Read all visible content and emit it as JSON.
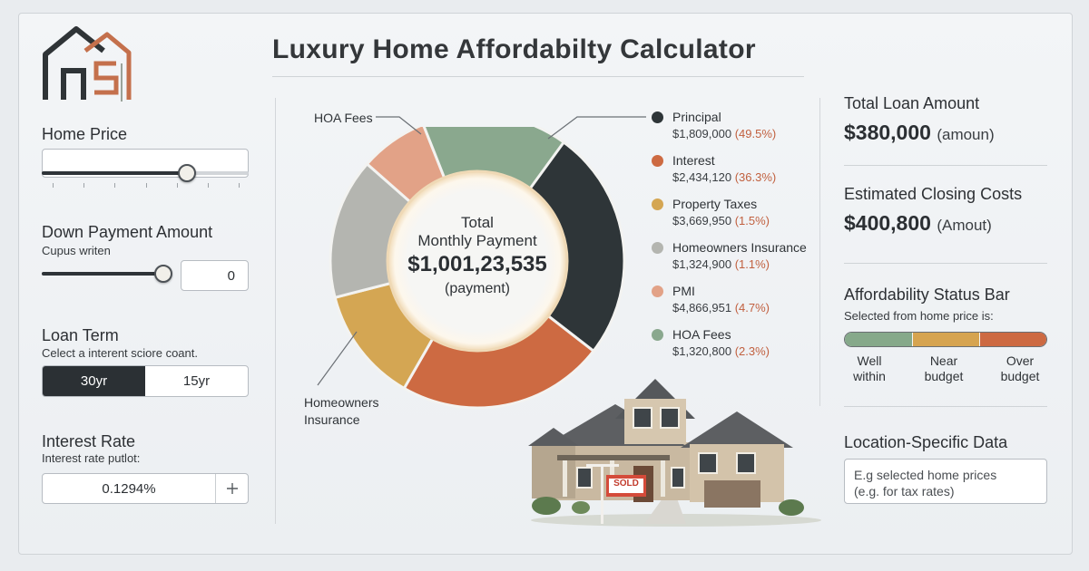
{
  "title": "Luxury Home Affordabilty Calculator",
  "colors": {
    "principal": "#2e3538",
    "interest": "#cd6a42",
    "property_taxes": "#d4a653",
    "homeowners_insurance": "#b4b5b0",
    "pmi": "#e2a287",
    "hoa_fees": "#8aa88e"
  },
  "inputs": {
    "home_price": {
      "label": "Home Price",
      "slider_level": 0.7
    },
    "down_payment": {
      "label": "Down Payment Amount",
      "caption": "Cupus writen",
      "value": "0",
      "slider_level": 1.0
    },
    "loan_term": {
      "label": "Loan Term",
      "caption": "Celect a interent sciore coant.",
      "options": [
        "30yr",
        "15yr"
      ],
      "selected": "30yr"
    },
    "interest_rate": {
      "label": "Interest Rate",
      "caption": "Interest rate putlot:",
      "value": "0.1294%",
      "stepper_icon": "plus-icon"
    }
  },
  "donut": {
    "center_line1": "Total",
    "center_line2": "Monthly Payment",
    "center_value": "$1,001,23,535",
    "center_unit": "(payment)",
    "callout_hoa": "HOA Fees",
    "callout_insurance": "Homeowners Insurance",
    "segments": [
      {
        "key": "principal",
        "share": 0.355
      },
      {
        "key": "interest",
        "share": 0.228
      },
      {
        "key": "property_taxes",
        "share": 0.127
      },
      {
        "key": "homeowners_insurance",
        "share": 0.155
      },
      {
        "key": "pmi",
        "share": 0.075
      },
      {
        "key": "hoa_fees",
        "share": 0.16
      }
    ]
  },
  "legend": [
    {
      "key": "principal",
      "name": "Principal",
      "amount": "$1,809,000",
      "pct": "(49.5%)"
    },
    {
      "key": "interest",
      "name": "Interest",
      "amount": "$2,434,120",
      "pct": "(36.3%)"
    },
    {
      "key": "property_taxes",
      "name": "Property Taxes",
      "amount": "$3,669,950",
      "pct": "(1.5%)"
    },
    {
      "key": "homeowners_insurance",
      "name": "Homeowners Insurance",
      "amount": "$1,324,900",
      "pct": "(1.1%)"
    },
    {
      "key": "pmi",
      "name": "PMI",
      "amount": "$4,866,951",
      "pct": "(4.7%)"
    },
    {
      "key": "hoa_fees",
      "name": "HOA Fees",
      "amount": "$1,320,800",
      "pct": "(2.3%)"
    }
  ],
  "summary": {
    "total_loan_label": "Total Loan Amount",
    "total_loan_value": "$380,000",
    "total_loan_unit": "(amoun)",
    "closing_label": "Estimated Closing Costs",
    "closing_value": "$400,800",
    "closing_unit": "(Amout)"
  },
  "status": {
    "label": "Affordability Status Bar",
    "caption": "Selected from home price is:",
    "segments": [
      {
        "label": "Well\nwithin",
        "color": "#86a98a"
      },
      {
        "label": "Near\nbudget",
        "color": "#d6a450"
      },
      {
        "label": "Over\nbudget",
        "color": "#cd6a42"
      }
    ]
  },
  "location": {
    "label": "Location-Specific Data",
    "placeholder": "E.g selected home prices\n(e.g. for tax rates)"
  },
  "house": {
    "sign_text": "SOLD"
  }
}
